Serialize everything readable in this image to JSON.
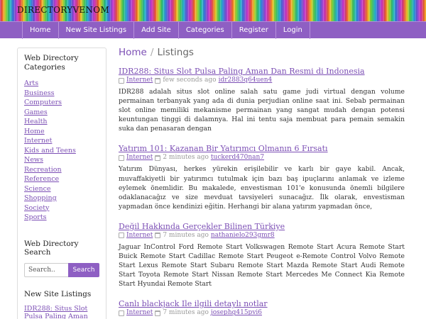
{
  "header": {
    "site_title": "DIRECTORYVENOM"
  },
  "nav": {
    "items": [
      "Home",
      "New Site Listings",
      "Add Site",
      "Categories",
      "Register",
      "Login"
    ]
  },
  "sidebar": {
    "categories_heading": "Web Directory Categories",
    "categories": [
      "Arts",
      "Business",
      "Computers",
      "Games",
      "Health",
      "Home",
      "Internet",
      "Kids and Teens",
      "News",
      "Recreation",
      "Reference",
      "Science",
      "Shopping",
      "Society",
      "Sports"
    ],
    "search_heading": "Web Directory Search",
    "search_placeholder": "Search..",
    "search_button": "Search",
    "new_listings_heading": "New Site Listings",
    "new_listing_first": "IDR288: Situs Slot",
    "new_listing_first_cont": "Pulsa Paling Aman"
  },
  "breadcrumb": {
    "home": "Home",
    "separator": "/",
    "current": "Listings"
  },
  "listings": [
    {
      "title": "IDR288: Situs Slot Pulsa Paling Aman Dan Resmi di Indonesia",
      "category": "Internet",
      "time": "few seconds ago",
      "user": "idr2883q64uen4",
      "body": "IDR288 adalah situs slot online salah satu game judi virtual dengan volume permainan terbanyak yang ada di dunia perjudian online saat ini. Sebab permainan slot online memiliki mekanisme permainan yang sangat mudah dengan potensi keuntungan tinggi di dalamnya. Hal ini tentu saja membuat para pemain semakin suka dan penasaran dengan"
    },
    {
      "title": "Yatırım 101: Kazanan Bir Yatırımcı Olmanın 6 Fırsatı",
      "category": "Internet",
      "time": "2 minutes ago",
      "user": "tuckerd470nan7",
      "body": "Yatırım Dünyası, herkes yürekin erişilebilir ve karlı bir gaye kabil. Ancak, muvaffakiyetli bir yatırımcı tutulmak için bazı baş ipuçlarını anlamak ve izleme eylemek önemlidir. Bu makalede, envestisman 101'e konusunda önemli bilgilere odaklanacağız ve size mevduat tavsiyeleri sunacağız. İlk olarak, envestisman yapmadan önce kendinizi eğitin. Herhangi bir alana yatırım yapmadan önce,"
    },
    {
      "title": "Değil Hakkında Gerçekler Bilinen Türkiye",
      "category": "Internet",
      "time": "7 minutes ago",
      "user": "nathanielo293gmr8",
      "body": "Jaguar InControl Ford Remote Start Volkswagen Remote Start Acura Remote Start Buick Remote Start Cadillac Remote Start Peugeot e-Remote Control Volvo Remote Start Lexus Remote Start Subaru Remote Start Mazda Remote Start Audi Remote Start Toyota Remote Start Nissan Remote Start Mercedes Me Connect Kia Remote Start Hyundai Remote Start"
    },
    {
      "title": "Canlı blackjack Ile ilgili detaylı notlar",
      "category": "Internet",
      "time": "7 minutes ago",
      "user": "josephg415pvi6",
      "body": ""
    }
  ]
}
